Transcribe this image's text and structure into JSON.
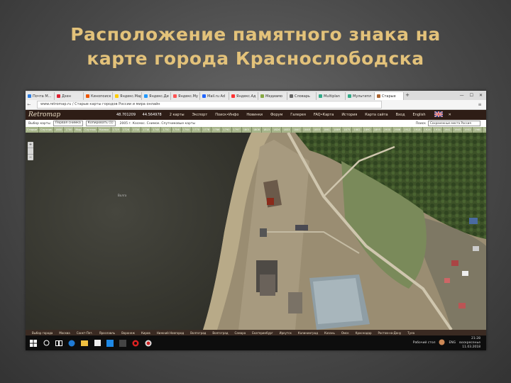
{
  "slide": {
    "title_line1": "Расположение памятного знака на",
    "title_line2": "карте города Краснослободска"
  },
  "browser": {
    "tabs": [
      {
        "label": "Почта М...",
        "color": "#2d7de0"
      },
      {
        "label": "Дзен",
        "color": "#d23"
      },
      {
        "label": "Кинопоиск",
        "color": "#e50"
      },
      {
        "label": "Яндекс.Мар",
        "color": "#fc0"
      },
      {
        "label": "Яндекс.Ди",
        "color": "#29f"
      },
      {
        "label": "Яндекс.Му",
        "color": "#f55"
      },
      {
        "label": "Mail.ru Ad",
        "color": "#26f"
      },
      {
        "label": "Яндекс.Ад",
        "color": "#f33"
      },
      {
        "label": "Медиамо",
        "color": "#8a4"
      },
      {
        "label": "Словарь",
        "color": "#666"
      },
      {
        "label": "Multiplan",
        "color": "#3a8"
      },
      {
        "label": "Мультипл",
        "color": "#3a8"
      },
      {
        "label": "Старые",
        "color": "#a63",
        "active": true
      }
    ],
    "new_tab": "+",
    "window_controls": [
      "—",
      "☐",
      "✕"
    ],
    "back": "←",
    "menu_icon": "≡",
    "url": "www.retromap.ru / Старые карты городов России и мира онлайн"
  },
  "site": {
    "logo": "Retromap",
    "coord_lat": "48.701209",
    "coord_lon": "44.564978",
    "menu": [
      "2 карты",
      "Экспорт",
      "Поиск•Инфо",
      "Новинки",
      "Форум",
      "Галерея",
      "FAQ•Карта",
      "История",
      "Карта сайта",
      "Вход",
      "English"
    ],
    "close": "✕"
  },
  "tools": {
    "type_label": "Выбор карты",
    "type_value": "Первая снимка",
    "mode": "Копировать (1)",
    "map_name": "2005 г. Космос. Снимок. Спутниковые карты",
    "search_label": "Поиск",
    "search_value": "Сохраненные места Россия"
  },
  "years": [
    "Старые",
    "Спутник",
    "1600",
    "1700",
    "Мир",
    "Спутник",
    "Космос",
    "1719",
    "1726",
    "1730",
    "1738",
    "1745",
    "1750",
    "1756",
    "1764",
    "1770",
    "1778",
    "1786",
    "1790",
    "1797",
    "1801",
    "1808",
    "1815",
    "1824",
    "1833",
    "1840",
    "1848",
    "1855",
    "1861",
    "1869",
    "1875",
    "1882",
    "1890",
    "1895",
    "1900",
    "1906",
    "1912",
    "1918",
    "1926",
    "1934",
    "1941",
    "1945",
    "1953",
    "1960",
    "1968",
    "1975",
    "1983",
    "1990",
    "1999",
    "2005",
    "2011",
    "Найти..."
  ],
  "highlight_year": "2005",
  "map": {
    "water_label": "Волга",
    "zoom_in": "+",
    "zoom_out": "−"
  },
  "cities": [
    "Выбор города",
    "Москва",
    "Санкт-Пет.",
    "Ярославль",
    "Воронеж",
    "Киров",
    "Нижний Новгород",
    "Волгоград",
    "Волгоград",
    "Самара",
    "Екатеринбург",
    "Иркутск",
    "Калининград",
    "Казань",
    "Омск",
    "Краснодар",
    "Ростов-на-Дону",
    "Тула"
  ],
  "taskbar": {
    "search_text": "Рабочий стол",
    "lang": "ENG",
    "time": "21:28",
    "date": "воскресенье",
    "date2": "11.03.2018"
  }
}
